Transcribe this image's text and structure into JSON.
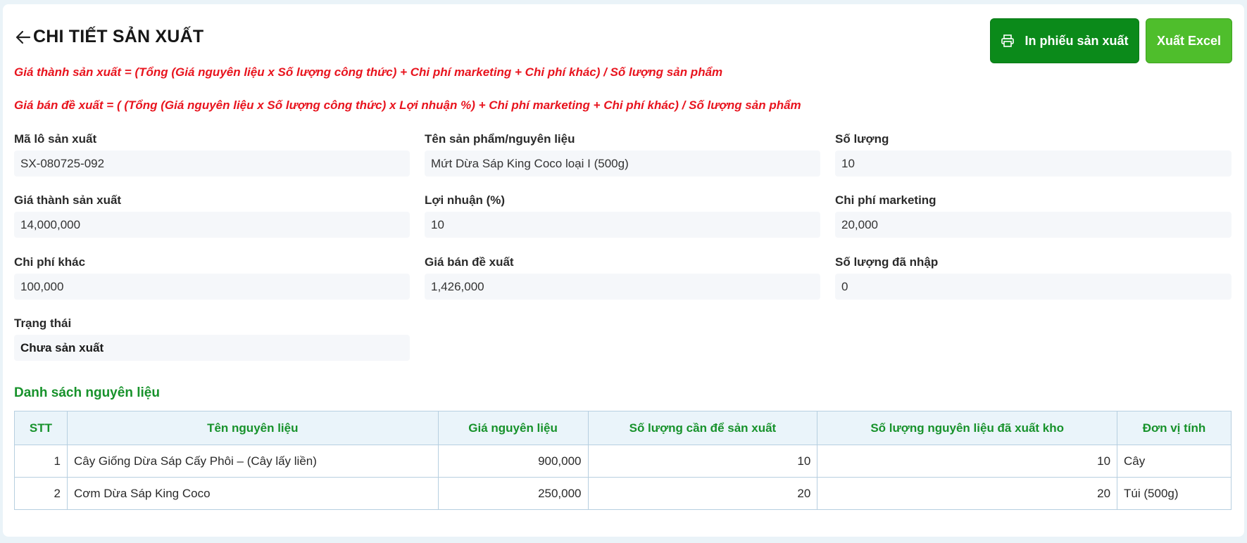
{
  "header": {
    "title": "CHI TIẾT SẢN XUẤT",
    "print_label": "In phiếu sản xuất",
    "excel_label": "Xuất Excel"
  },
  "formulas": {
    "cost": "Giá thành sản xuất = (Tổng (Giá nguyên liệu x Số lượng công thức) + Chi phí marketing + Chi phí khác) / Số lượng sản phẩm",
    "price": "Giá bán đề xuất = ( (Tổng (Giá nguyên liệu x Số lượng công thức) x Lợi nhuận %) + Chi phí marketing + Chi phí khác) / Số lượng sản phẩm"
  },
  "fields": {
    "batch_code": {
      "label": "Mã lô sản xuất",
      "value": "SX-080725-092"
    },
    "product_name": {
      "label": "Tên sản phẩm/nguyên liệu",
      "value": "Mứt Dừa Sáp King Coco loại I (500g)"
    },
    "quantity": {
      "label": "Số lượng",
      "value": "10"
    },
    "production_cost": {
      "label": "Giá thành sản xuất",
      "value": "14,000,000"
    },
    "profit": {
      "label": "Lợi nhuận (%)",
      "value": "10"
    },
    "marketing_cost": {
      "label": "Chi phí marketing",
      "value": "20,000"
    },
    "other_cost": {
      "label": "Chi phí khác",
      "value": "100,000"
    },
    "suggested_price": {
      "label": "Giá bán đề xuất",
      "value": "1,426,000"
    },
    "imported_qty": {
      "label": "Số lượng đã nhập",
      "value": "0"
    },
    "status": {
      "label": "Trạng thái",
      "value": "Chưa sản xuất"
    }
  },
  "materials": {
    "title": "Danh sách nguyên liệu",
    "columns": [
      "STT",
      "Tên nguyên liệu",
      "Giá nguyên liệu",
      "Số lượng cần để sản xuất",
      "Số lượng nguyên liệu đã xuất kho",
      "Đơn vị tính"
    ],
    "rows": [
      [
        "1",
        "Cây Giống Dừa Sáp Cấy Phôi – (Cây lấy liền)",
        "900,000",
        "10",
        "10",
        "Cây"
      ],
      [
        "2",
        "Cơm Dừa Sáp King Coco",
        "250,000",
        "20",
        "20",
        "Túi (500g)"
      ]
    ]
  },
  "colors": {
    "accent_green": "#17922b",
    "print_button": "#0b8a1a",
    "excel_button": "#4fbe2c",
    "formula_red": "#e8141e"
  },
  "icons": [
    "arrow-left-icon",
    "printer-icon"
  ]
}
